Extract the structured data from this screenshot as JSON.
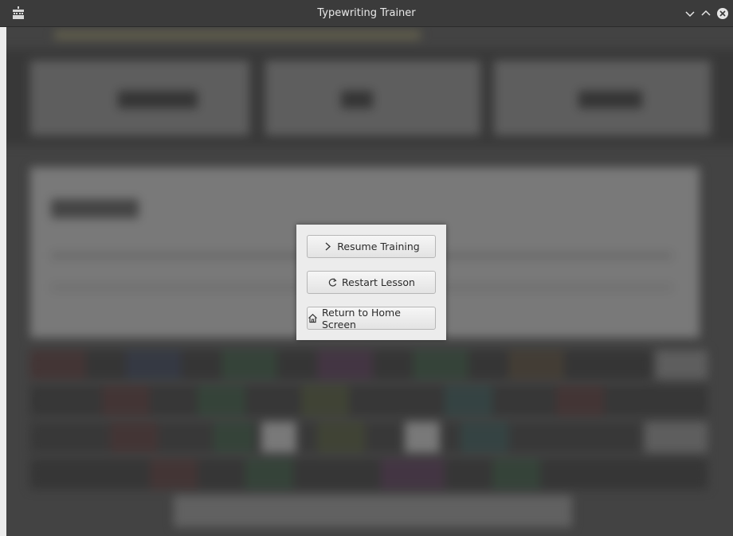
{
  "window": {
    "title": "Typewriting Trainer",
    "controls": [
      "minimize-icon",
      "maximize-icon",
      "close-icon"
    ]
  },
  "app_icon": "typewriter-icon",
  "pause_menu": {
    "items": [
      {
        "label": "Resume Training",
        "icon": "chevron-right-icon"
      },
      {
        "label": "Restart Lesson",
        "icon": "refresh-icon"
      },
      {
        "label": "Return to Home Screen",
        "icon": "home-icon"
      }
    ]
  },
  "background_stats_blurred": {
    "elapsed_time": "00:25.4",
    "strokes_per_minute": "68",
    "accuracy": "90.0%"
  },
  "background_lesson_text_blurred": "j asdf f",
  "colors": {
    "titlebar": "#3b3b3b",
    "menu_panel": "#ececec",
    "overlay_background": "#4a4a4a"
  }
}
